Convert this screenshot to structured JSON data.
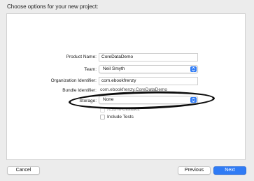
{
  "dialog": {
    "heading": "Choose options for your new project:"
  },
  "form": {
    "product_name_label": "Product Name:",
    "product_name_value": "CoreDataDemo",
    "team_label": "Team:",
    "team_value": "Neil Smyth",
    "org_id_label": "Organization Identifier:",
    "org_id_value": "com.ebookfrenzy",
    "bundle_id_label": "Bundle Identifier:",
    "bundle_id_value": "com.ebookfrenzy.CoreDataDemo",
    "storage_label": "Storage:",
    "storage_value": "None",
    "host_cloudkit_label": "Host in CloudKit",
    "include_tests_label": "Include Tests"
  },
  "footer": {
    "cancel_label": "Cancel",
    "previous_label": "Previous",
    "next_label": "Next"
  },
  "colors": {
    "accent": "#2f7bf5",
    "annotation": "#0c0c0c"
  },
  "icons": {
    "popup_indicator": "chevron-up-down-icon"
  }
}
